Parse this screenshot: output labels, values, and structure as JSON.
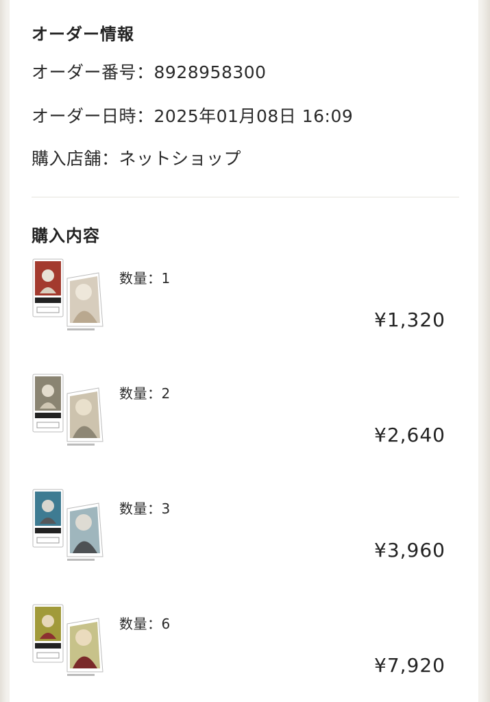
{
  "order_info": {
    "title": "オーダー情報",
    "order_number_label": "オーダー番号：",
    "order_number": "8928958300",
    "order_datetime_label": "オーダー日時：",
    "order_datetime": "2025年01月08日 16:09",
    "store_label": "購入店舗：",
    "store": "ネットショップ"
  },
  "purchase": {
    "title": "購入内容",
    "items": [
      {
        "quantity_label": "数量：1",
        "price": "¥1,320",
        "theme_color": "#a33a2e",
        "image": "acrylic-stand-character-1"
      },
      {
        "quantity_label": "数量：2",
        "price": "¥2,640",
        "theme_color": "#8a8472",
        "image": "acrylic-stand-character-2"
      },
      {
        "quantity_label": "数量：3",
        "price": "¥3,960",
        "theme_color": "#3e7b92",
        "image": "acrylic-stand-character-3"
      },
      {
        "quantity_label": "数量：6",
        "price": "¥7,920",
        "theme_color": "#a19a3a",
        "image": "acrylic-stand-character-4"
      }
    ]
  }
}
